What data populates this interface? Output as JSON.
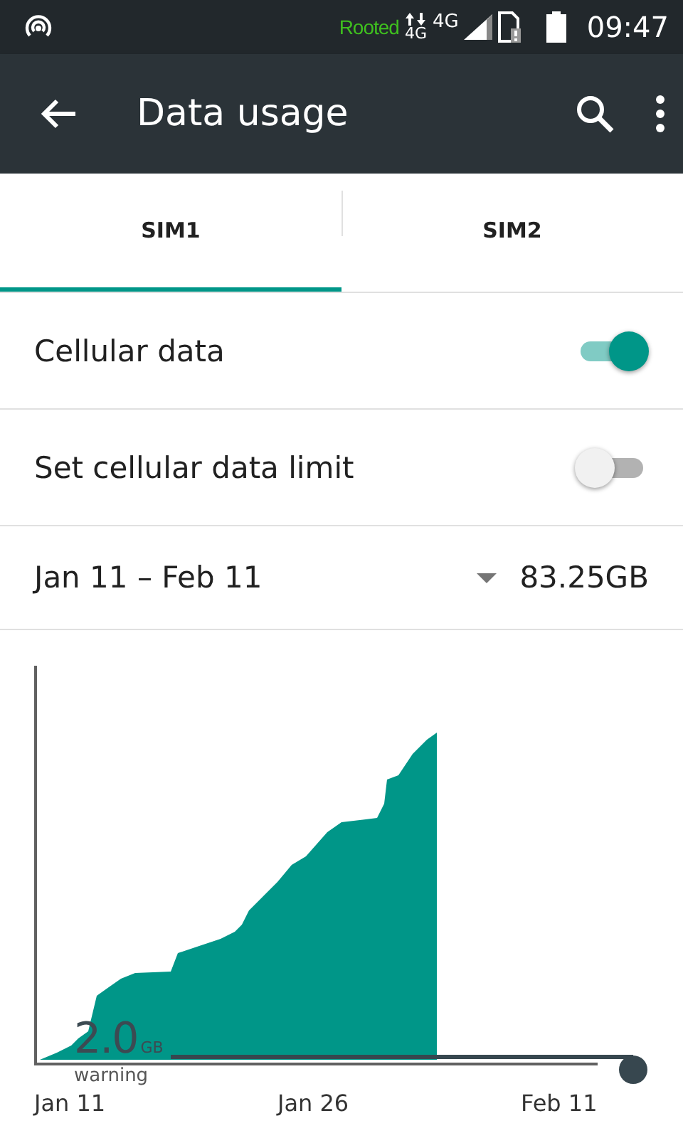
{
  "status_bar": {
    "root_label": "Rooted",
    "network_small": "4G",
    "network": "4G",
    "time": "09:47"
  },
  "toolbar": {
    "title": "Data usage"
  },
  "tabs": [
    {
      "label": "SIM1",
      "selected": true
    },
    {
      "label": "SIM2",
      "selected": false
    }
  ],
  "settings": [
    {
      "label": "Cellular data",
      "on": true
    },
    {
      "label": "Set cellular data limit",
      "on": false
    }
  ],
  "cycle": {
    "range": "Jan 11 – Feb 11",
    "total": "83.25GB"
  },
  "chart": {
    "warning_value": "2.0",
    "warning_unit": "GB",
    "warning_label": "warning",
    "x_labels": [
      "Jan 11",
      "Jan 26",
      "Feb 11"
    ]
  }
}
